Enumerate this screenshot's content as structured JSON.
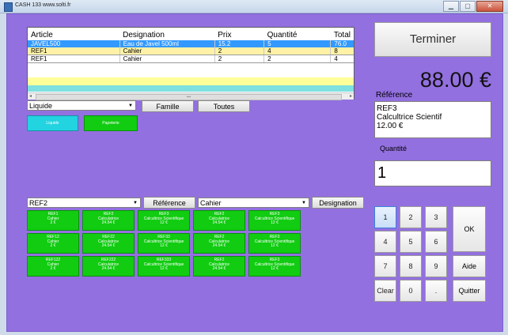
{
  "window": {
    "title": "CASH 133 www.solti.fr",
    "buttons": [
      "minimize",
      "maximize",
      "close"
    ]
  },
  "grid": {
    "headers": [
      "Article",
      "Designation",
      "Prix",
      "Quantité",
      "Total"
    ],
    "rows": [
      [
        "JAVEL500",
        "Eau de Javel 500ml",
        "15.2",
        "5",
        "76.0"
      ],
      [
        "REF1",
        "Cahier",
        "2",
        "4",
        "8"
      ],
      [
        "REF1",
        "Cahier",
        "2",
        "2",
        "4"
      ]
    ]
  },
  "filters": {
    "category_select": "Liquide",
    "famille_button": "Famille",
    "toutes_button": "Toutes",
    "categories": [
      "Liquide",
      "Papeterie"
    ]
  },
  "search": {
    "ref_select": "REF2",
    "reference_button": "Référence",
    "designation_select": "Cahier",
    "designation_button": "Designation"
  },
  "tiles": [
    [
      [
        "REF1",
        "Cahier",
        "2 €"
      ],
      [
        "REF2",
        "Calculatrice",
        "24.54 €"
      ],
      [
        "REF3",
        "Calcultrice Scientifique",
        "12 €"
      ],
      [
        "REF2",
        "Calculatrice",
        "24.54 €"
      ],
      [
        "REF3",
        "Calcultrice Scientifique",
        "12 €"
      ]
    ],
    [
      [
        "REF12",
        "Cahier",
        "2 €"
      ],
      [
        "REF22",
        "Calculatrice",
        "24.54 €"
      ],
      [
        "REF33",
        "Calcultrice Scientifique",
        "12 €"
      ],
      [
        "REF2",
        "Calculatrice",
        "24.54 €"
      ],
      [
        "REF3",
        "Calcultrice Scientifique",
        "12 €"
      ]
    ],
    [
      [
        "REF122",
        "Cahier",
        "2 €"
      ],
      [
        "REF222",
        "Calculatrice",
        "24.54 €"
      ],
      [
        "REF333",
        "Calcultrice Scientifique",
        "12 €"
      ],
      [
        "REF2",
        "Calculatrice",
        "24.54 €"
      ],
      [
        "REF3",
        "Calcultrice Scientifique",
        "12 €"
      ]
    ]
  ],
  "right": {
    "terminer_button": "Terminer",
    "total": "88.00 €",
    "reference_label": "Référence",
    "reference_lines": [
      "REF3",
      "Calcultrice Scientif",
      "12.00 €"
    ],
    "quantite_label": "Quantité",
    "quantite_value": "1"
  },
  "keypad": {
    "keys": [
      "1",
      "2",
      "3",
      "4",
      "5",
      "6",
      "7",
      "8",
      "9",
      "Clear",
      "0",
      "."
    ],
    "ok": "OK",
    "aide": "Aide",
    "quitter": "Quitter"
  },
  "colors": {
    "background": "#9370e0",
    "tile": "#11cc11",
    "selected_row": "#3399ff",
    "category_liquide": "#22d3e0",
    "category_papeterie": "#11cc11"
  }
}
